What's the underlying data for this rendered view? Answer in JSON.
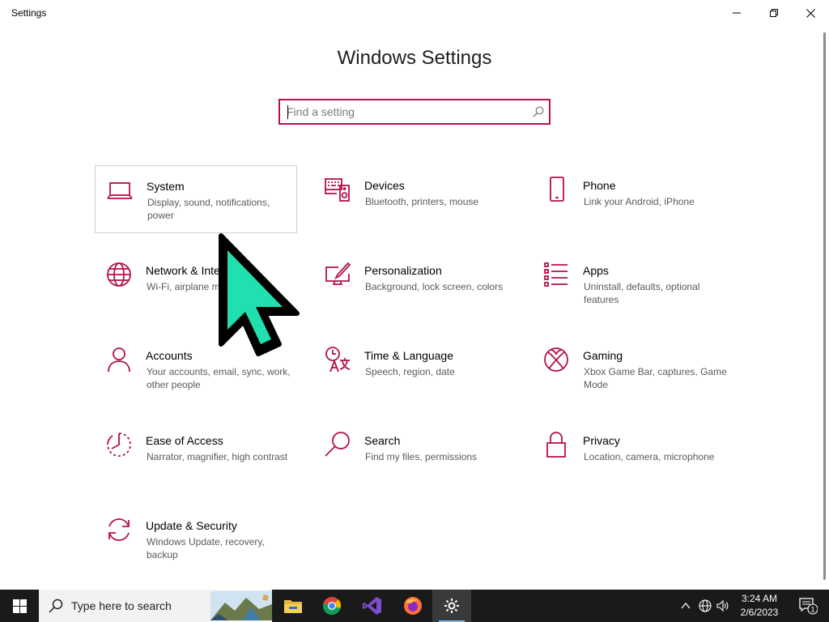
{
  "window": {
    "title": "Settings"
  },
  "header": {
    "title": "Windows Settings"
  },
  "search": {
    "placeholder": "Find a setting"
  },
  "accent_color": "#b5114d",
  "tiles": [
    {
      "name": "System",
      "description": "Display, sound, notifications, power",
      "icon": "laptop-icon",
      "selected": true
    },
    {
      "name": "Devices",
      "description": "Bluetooth, printers, mouse",
      "icon": "keyboard-speaker-icon"
    },
    {
      "name": "Phone",
      "description": "Link your Android, iPhone",
      "icon": "phone-icon"
    },
    {
      "name": "Network & Internet",
      "description": "Wi-Fi, airplane mode, VPN",
      "icon": "globe-icon"
    },
    {
      "name": "Personalization",
      "description": "Background, lock screen, colors",
      "icon": "paint-monitor-icon"
    },
    {
      "name": "Apps",
      "description": "Uninstall, defaults, optional features",
      "icon": "apps-list-icon"
    },
    {
      "name": "Accounts",
      "description": "Your accounts, email, sync, work, other people",
      "icon": "person-icon"
    },
    {
      "name": "Time & Language",
      "description": "Speech, region, date",
      "icon": "time-language-icon"
    },
    {
      "name": "Gaming",
      "description": "Xbox Game Bar, captures, Game Mode",
      "icon": "xbox-icon"
    },
    {
      "name": "Ease of Access",
      "description": "Narrator, magnifier, high contrast",
      "icon": "ease-of-access-icon"
    },
    {
      "name": "Search",
      "description": "Find my files, permissions",
      "icon": "magnifier-icon"
    },
    {
      "name": "Privacy",
      "description": "Location, camera, microphone",
      "icon": "lock-icon"
    },
    {
      "name": "Update & Security",
      "description": "Windows Update, recovery, backup",
      "icon": "update-arrows-icon"
    }
  ],
  "taskbar": {
    "search_placeholder": "Type here to search",
    "apps": [
      "file-explorer-icon",
      "chrome-icon",
      "visual-studio-icon",
      "firefox-icon",
      "settings-gear-icon"
    ],
    "clock": {
      "time": "3:24 AM",
      "date": "2/6/2023"
    },
    "notification_count": "1"
  }
}
